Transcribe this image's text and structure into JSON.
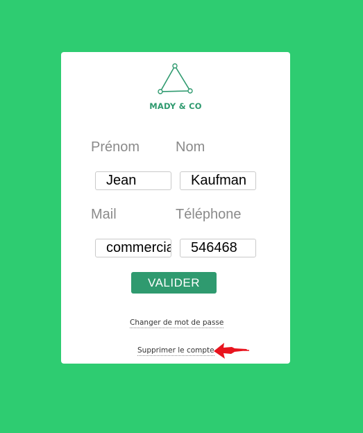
{
  "brand": {
    "name": "MADY & CO",
    "logo_icon": "triangle-logo-icon",
    "color": "#2f9a6f"
  },
  "background_color": "#2ecc71",
  "form": {
    "first_name_label": "Prénom",
    "last_name_label": "Nom",
    "first_name_value": "Jean",
    "last_name_value": "Kaufman",
    "mail_label": "Mail",
    "phone_label": "Téléphone",
    "mail_value": "commercial@madyandco.com",
    "phone_value": "546468",
    "submit_label": "VALIDER"
  },
  "links": {
    "change_password": "Changer de mot de passe",
    "delete_account": "Supprimer le compte"
  },
  "annotation": {
    "icon": "red-arrow-icon",
    "color": "#e8141e"
  }
}
